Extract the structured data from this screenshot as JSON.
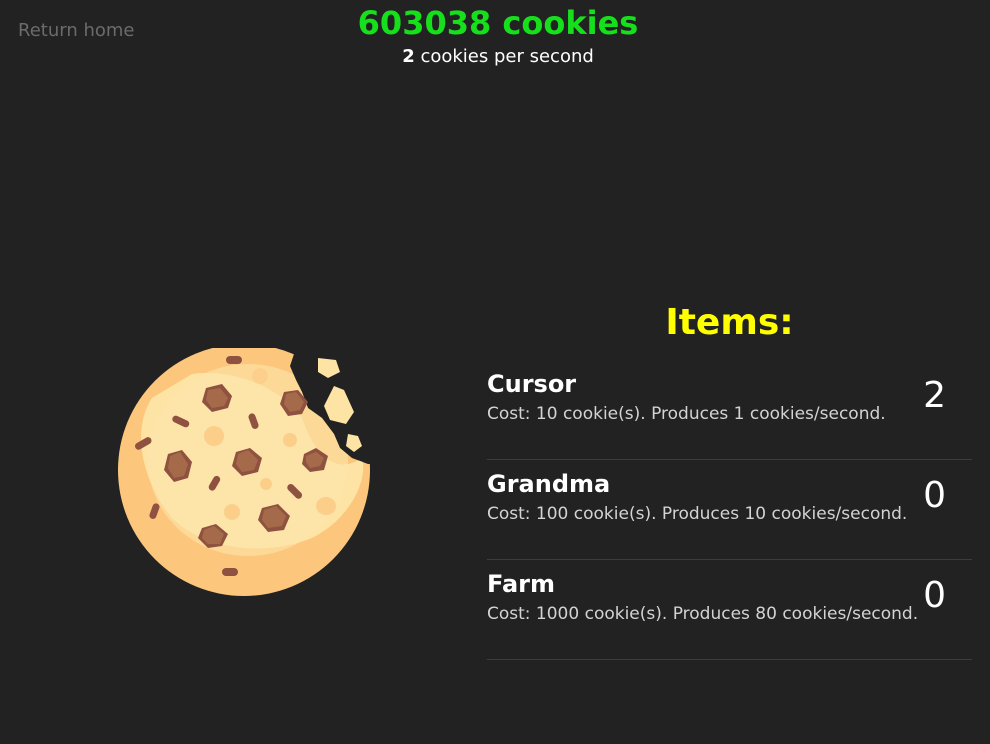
{
  "nav": {
    "return_home": "Return home"
  },
  "header": {
    "cookie_count": "603038 cookies",
    "cps_value": "2",
    "cps_suffix": " cookies per second"
  },
  "cookie": {
    "icon": "cookie-icon"
  },
  "items_panel": {
    "title": "Items:",
    "items": [
      {
        "name": "Cursor",
        "description": "Cost: 10 cookie(s). Produces 1 cookies/second.",
        "owned": "2"
      },
      {
        "name": "Grandma",
        "description": "Cost: 100 cookie(s). Produces 10 cookies/second.",
        "owned": "0"
      },
      {
        "name": "Farm",
        "description": "Cost: 1000 cookie(s). Produces 80 cookies/second.",
        "owned": "0"
      }
    ]
  },
  "colors": {
    "background": "#222222",
    "cookie_count": "#16e01c",
    "items_title": "#ffff00",
    "return_link": "#6b6b6b"
  }
}
